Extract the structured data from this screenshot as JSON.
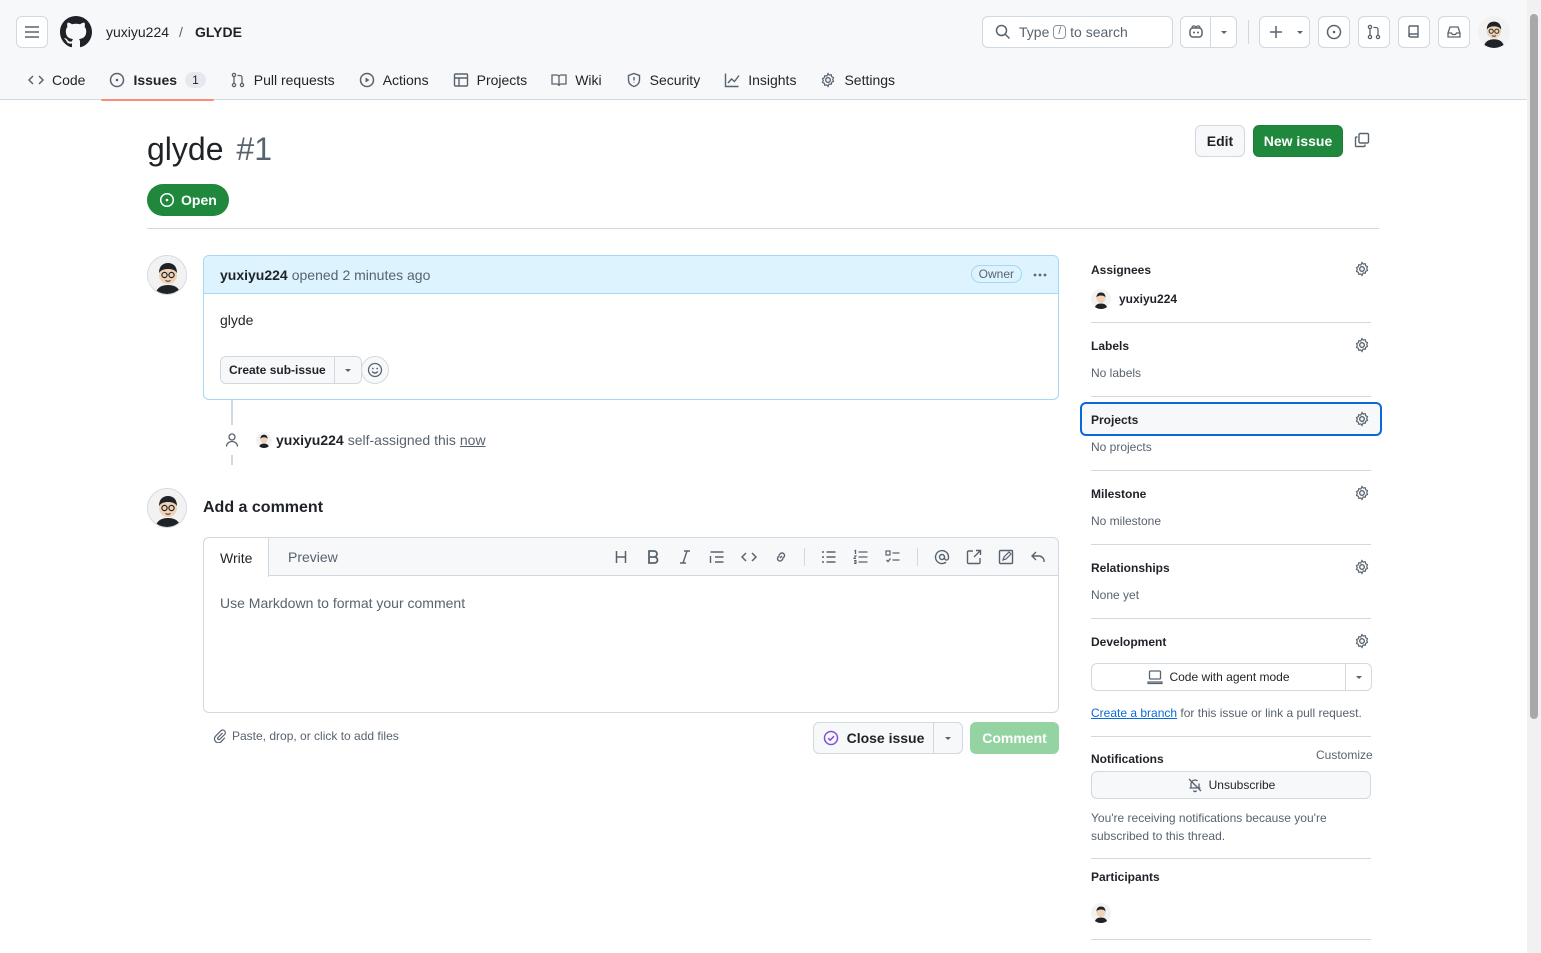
{
  "header": {
    "owner": "yuxiyu224",
    "separator": "/",
    "repo": "GLYDE",
    "search": {
      "prefix": "Type",
      "key": "/",
      "suffix": "to search"
    }
  },
  "tabs": [
    {
      "label": "Code",
      "icon": "code-icon"
    },
    {
      "label": "Issues",
      "icon": "issue-opened-icon",
      "count": "1"
    },
    {
      "label": "Pull requests",
      "icon": "git-pull-request-icon"
    },
    {
      "label": "Actions",
      "icon": "play-icon"
    },
    {
      "label": "Projects",
      "icon": "table-icon"
    },
    {
      "label": "Wiki",
      "icon": "book-icon"
    },
    {
      "label": "Security",
      "icon": "shield-icon"
    },
    {
      "label": "Insights",
      "icon": "graph-icon"
    },
    {
      "label": "Settings",
      "icon": "gear-icon"
    }
  ],
  "issue": {
    "title": "glyde",
    "number": "#1",
    "state": "Open",
    "edit_label": "Edit",
    "new_issue_label": "New issue"
  },
  "comment": {
    "author": "yuxiyu224",
    "action": "opened",
    "time": "2 minutes ago",
    "role": "Owner",
    "body": "glyde",
    "sub_issue_label": "Create sub-issue"
  },
  "event": {
    "actor": "yuxiyu224",
    "text": "self-assigned this",
    "time": "now"
  },
  "editor": {
    "heading": "Add a comment",
    "tab_write": "Write",
    "tab_preview": "Preview",
    "placeholder": "Use Markdown to format your comment",
    "attach": "Paste, drop, or click to add files",
    "close_label": "Close issue",
    "comment_label": "Comment"
  },
  "sidebar": {
    "assignees": {
      "title": "Assignees",
      "user": "yuxiyu224"
    },
    "labels": {
      "title": "Labels",
      "value": "No labels"
    },
    "projects": {
      "title": "Projects",
      "value": "No projects"
    },
    "milestone": {
      "title": "Milestone",
      "value": "No milestone"
    },
    "relationships": {
      "title": "Relationships",
      "value": "None yet"
    },
    "development": {
      "title": "Development",
      "agent_label": "Code with agent mode",
      "link_text": "Create a branch",
      "rest": "for this issue or link a pull request."
    },
    "notifications": {
      "title": "Notifications",
      "customize": "Customize",
      "unsubscribe": "Unsubscribe",
      "reason": "You're receiving notifications because you're subscribed to this thread."
    },
    "participants": {
      "title": "Participants"
    }
  },
  "colors": {
    "primary_green": "#1f883d",
    "accent_blue": "#0969da",
    "tab_underline": "#fd8c73"
  }
}
